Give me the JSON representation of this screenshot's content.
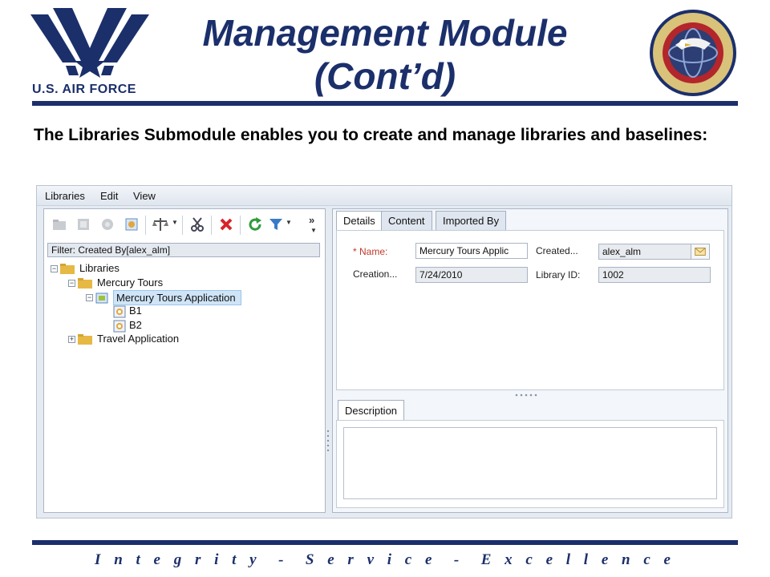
{
  "slide": {
    "title_line1": "Management Module",
    "title_line2": "(Cont’d)",
    "subtitle": "The Libraries Submodule enables you to create and manage libraries and baselines:",
    "footer": "I n t e g r i t y  -  S e r v i c e  -  E x c e l l e n c e",
    "logo_text": "U.S. AIR FORCE",
    "seal_text": "AIR FORCE LIFE CYCLE MANAGEMENT CENTER · BUSINESS AND ENTERPRISE SYSTEMS"
  },
  "colors": {
    "brand_navy": "#1b2f6b",
    "required_red": "#c0392b",
    "selection_blue": "#cfe4f7"
  },
  "app": {
    "menu": [
      "Libraries",
      "Edit",
      "View"
    ],
    "toolbar_icons": [
      "new-folder-icon",
      "new-library-icon",
      "new-baseline-icon",
      "import-icon",
      "compare-icon",
      "cut-icon",
      "delete-icon",
      "refresh-icon",
      "filter-icon",
      "more-icon"
    ],
    "filter": "Filter: Created By[alex_alm]",
    "tree": {
      "root": "Libraries",
      "folder1": "Mercury Tours",
      "library": "Mercury Tours Application",
      "baseline1": "B1",
      "baseline2": "B2",
      "folder2": "Travel Application"
    },
    "tabs": [
      "Details",
      "Content",
      "Imported By"
    ],
    "details": {
      "name_label": "* Name:",
      "name_value": "Mercury Tours Applic",
      "created_by_label": "Created...",
      "created_by_value": "alex_alm",
      "creation_label": "Creation...",
      "creation_value": "7/24/2010",
      "library_id_label": "Library ID:",
      "library_id_value": "1002"
    },
    "description_tab": "Description"
  }
}
